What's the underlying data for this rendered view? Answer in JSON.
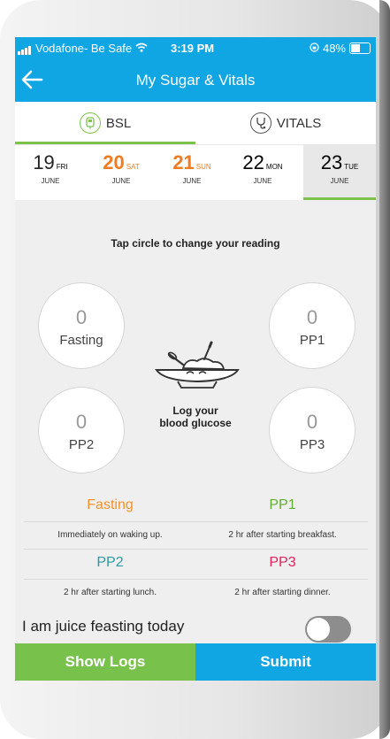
{
  "status_bar": {
    "carrier": "Vodafone- Be Safe",
    "time": "3:19 PM",
    "battery": "48%"
  },
  "header": {
    "title": "My Sugar & Vitals"
  },
  "tabs": [
    {
      "label": "BSL",
      "active": true
    },
    {
      "label": "VITALS",
      "active": false
    }
  ],
  "dates": [
    {
      "day": "19",
      "weekday": "FRI",
      "month": "JUNE",
      "color": "#222222",
      "selected": false
    },
    {
      "day": "20",
      "weekday": "SAT",
      "month": "JUNE",
      "color": "#f07b21",
      "selected": false
    },
    {
      "day": "21",
      "weekday": "SUN",
      "month": "JUNE",
      "color": "#f07b21",
      "selected": false
    },
    {
      "day": "22",
      "weekday": "MON",
      "month": "JUNE",
      "color": "#222222",
      "selected": false
    },
    {
      "day": "23",
      "weekday": "TUE",
      "month": "JUNE",
      "color": "#222222",
      "selected": true
    }
  ],
  "instruction": "Tap circle to change your reading",
  "readings": {
    "fasting": {
      "value": "0",
      "label": "Fasting"
    },
    "pp1": {
      "value": "0",
      "label": "PP1"
    },
    "pp2": {
      "value": "0",
      "label": "PP2"
    },
    "pp3": {
      "value": "0",
      "label": "PP3"
    }
  },
  "center_label_line1": "Log your",
  "center_label_line2": "blood glucose",
  "legend": {
    "fasting": {
      "title": "Fasting",
      "desc": "Immediately on waking up.",
      "color": "#f2922a"
    },
    "pp1": {
      "title": "PP1",
      "desc": "2 hr after starting breakfast.",
      "color": "#5fae32"
    },
    "pp2": {
      "title": "PP2",
      "desc": "2 hr after starting lunch.",
      "color": "#2b9ba3"
    },
    "pp3": {
      "title": "PP3",
      "desc": "2 hr after starting dinner.",
      "color": "#e0245e"
    }
  },
  "juice_label": "I am juice feasting today",
  "juice_toggle_on": false,
  "buttons": {
    "show_logs": "Show Logs",
    "submit": "Submit"
  },
  "colors": {
    "header": "#10a6e3",
    "accent_green": "#78c14b"
  }
}
